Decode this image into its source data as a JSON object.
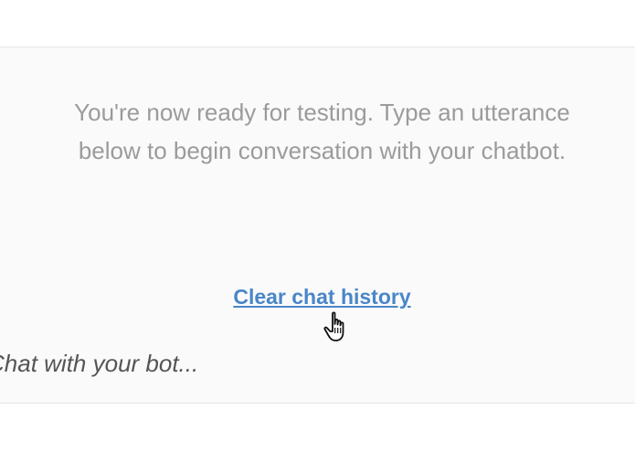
{
  "chat_panel": {
    "intro_line_1": "You're now ready for testing. Type an utterance",
    "intro_line_2": "below to begin conversation with your chatbot.",
    "clear_link_label": "Clear chat history",
    "input_placeholder": "Chat with your bot...",
    "cursor_icon": "hand-pointer-icon"
  },
  "colors": {
    "link": "#4a86c8",
    "intro_text": "#9b9b9b",
    "panel_background": "#fafafb"
  }
}
